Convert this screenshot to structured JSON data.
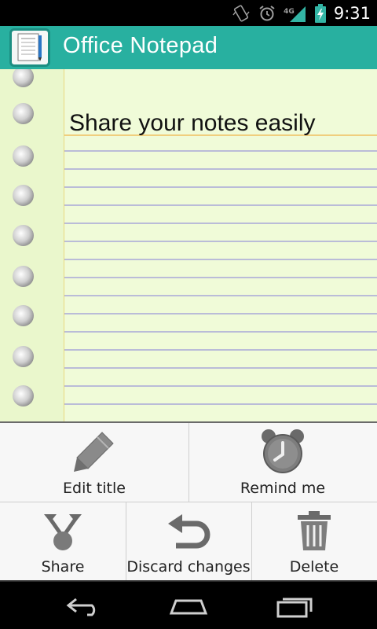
{
  "status_bar": {
    "network": "4G",
    "time": "9:31"
  },
  "action_bar": {
    "app_title": "Office Notepad"
  },
  "note": {
    "title": "Share your notes easily"
  },
  "menu": {
    "items": [
      {
        "label": "Edit title",
        "icon": "pencil-icon"
      },
      {
        "label": "Remind me",
        "icon": "alarm-clock-icon"
      },
      {
        "label": "Share",
        "icon": "share-icon"
      },
      {
        "label": "Discard changes",
        "icon": "undo-icon"
      },
      {
        "label": "Delete",
        "icon": "trash-icon"
      }
    ]
  },
  "nav_bar": {
    "buttons": [
      "back-icon",
      "home-icon",
      "recents-icon"
    ]
  },
  "colors": {
    "action_bar": "#28b0a0",
    "paper": "#f0fbd8",
    "ruled_line": "#a8a8d8"
  }
}
